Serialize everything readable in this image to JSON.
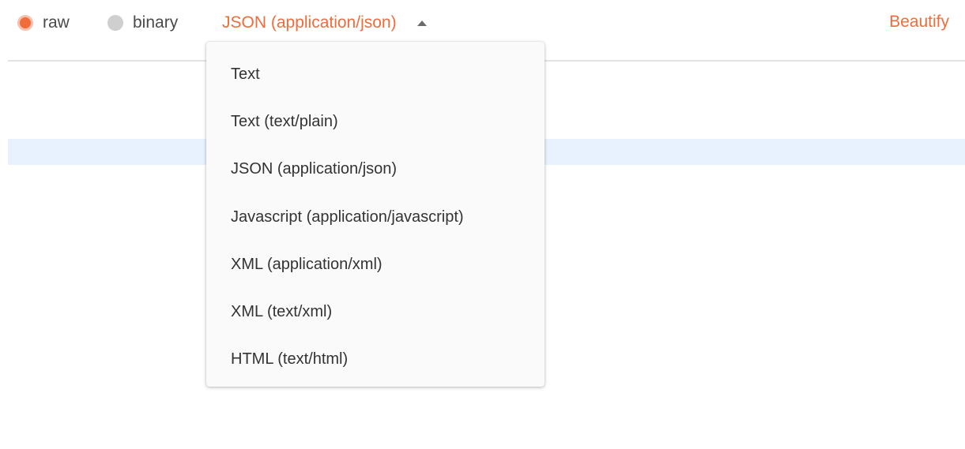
{
  "toolbar": {
    "body_modes": [
      {
        "label": "raw",
        "selected": true
      },
      {
        "label": "binary",
        "selected": false
      }
    ],
    "content_type_selected": "JSON (application/json)",
    "beautify_label": "Beautify"
  },
  "dropdown": {
    "open": true,
    "options": [
      "Text",
      "Text (text/plain)",
      "JSON (application/json)",
      "Javascript (application/javascript)",
      "XML (application/xml)",
      "XML (text/xml)",
      "HTML (text/html)"
    ]
  },
  "colors": {
    "accent": "#f26b3a",
    "radio_unselected": "#cfcfcf",
    "text": "#4a4a4a",
    "active_line": "#e8f2ff",
    "menu_background": "#fafafa"
  },
  "icons": {
    "dropdown_caret": "caret-up-icon"
  }
}
